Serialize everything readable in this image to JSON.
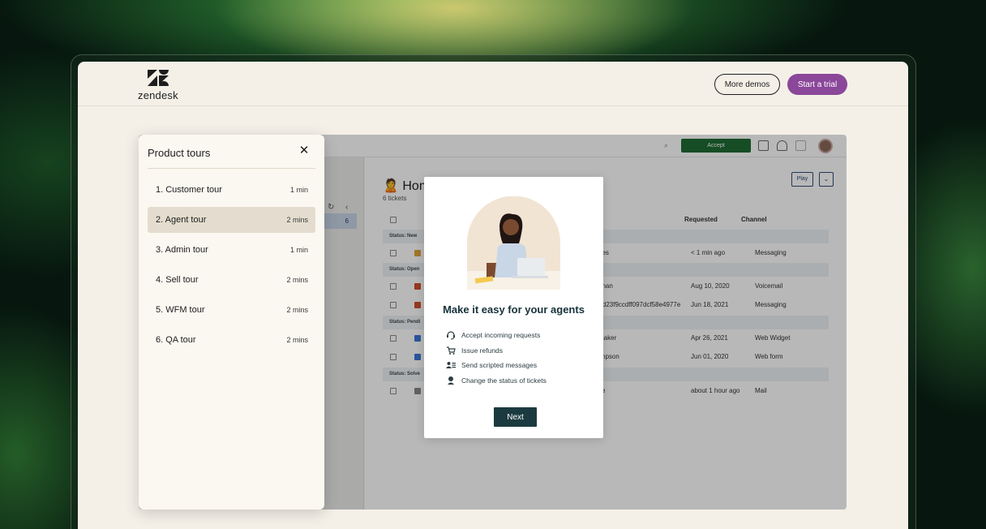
{
  "header": {
    "logo_text": "zendesk",
    "more_demos_label": "More demos",
    "start_trial_label": "Start a trial"
  },
  "app_preview": {
    "accept_label": "Accept",
    "view_count": "6",
    "home_title": "Home",
    "tickets_count": "6 tickets",
    "play_label": "Play",
    "columns": {
      "requested": "Requested",
      "channel": "Channel"
    },
    "status_new": "Status: New",
    "status_open": "Status: Open",
    "status_pending": "Status: Pendi",
    "status_solved": "Status: Solve",
    "rows": [
      {
        "requester": "nes",
        "requested": "< 1 min ago",
        "channel": "Messaging"
      },
      {
        "requester": "enan",
        "requested": "Aug 10, 2020",
        "channel": "Voicemail"
      },
      {
        "requester": "r d23f9ccdff097dcf58e4977e",
        "requested": "Jun 18, 2021",
        "channel": "Messaging"
      },
      {
        "requester": "maker",
        "requested": "Apr 26, 2021",
        "channel": "Web Widget"
      },
      {
        "requester": "impson",
        "requested": "Jun 01, 2020",
        "channel": "Web form"
      },
      {
        "requester": "ce",
        "requested": "about 1 hour ago",
        "channel": "Mail"
      }
    ]
  },
  "tours": {
    "title": "Product tours",
    "items": [
      {
        "name": "1. Customer tour",
        "duration": "1 min"
      },
      {
        "name": "2. Agent tour",
        "duration": "2 mins",
        "active": true
      },
      {
        "name": "3. Admin tour",
        "duration": "1 min"
      },
      {
        "name": "4. Sell tour",
        "duration": "2 mins"
      },
      {
        "name": "5. WFM tour",
        "duration": "2 mins"
      },
      {
        "name": "6. QA tour",
        "duration": "2 mins"
      }
    ]
  },
  "modal": {
    "title": "Make it easy for your agents",
    "features": [
      {
        "icon": "headset-icon",
        "text": "Accept incoming requests"
      },
      {
        "icon": "cart-icon",
        "text": "Issue refunds"
      },
      {
        "icon": "user-list-icon",
        "text": "Send scripted messages"
      },
      {
        "icon": "agent-status-icon",
        "text": "Change the status of tickets"
      }
    ],
    "next_label": "Next"
  },
  "colors": {
    "brand_purple": "#8b4799",
    "dark_teal": "#1b3a3f",
    "accept_green": "#1f6b33"
  }
}
